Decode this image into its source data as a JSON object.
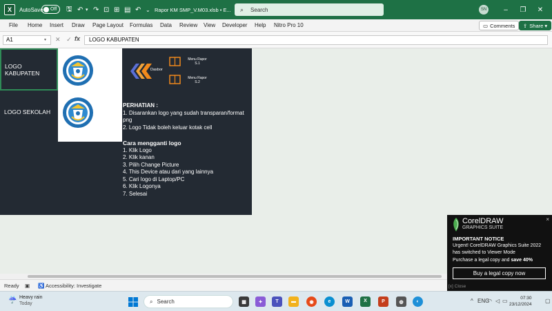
{
  "titlebar": {
    "excel_logo": "X",
    "autosave_label": "AutoSave",
    "autosave_state": "Off",
    "doc_title": "Rapor KM SMP_V.M03.xlsb  •  E...",
    "search_placeholder": "Search",
    "user_initials": "SN",
    "bg_color": "#1e7145"
  },
  "ribbon": {
    "tabs": [
      "File",
      "Home",
      "Insert",
      "Draw",
      "Page Layout",
      "Formulas",
      "Data",
      "Review",
      "View",
      "Developer",
      "Help",
      "Nitro Pro 10"
    ],
    "comments_label": "Comments",
    "share_label": "Share"
  },
  "formula_bar": {
    "name_box": "A1",
    "fx_label": "fx",
    "content": "LOGO KABUPATEN"
  },
  "sheet": {
    "cell_a1": "LOGO KABUPATEN",
    "cell_a2": "LOGO SEKOLAH",
    "nav": {
      "dasbor": "Dasbor",
      "menu1": "Menu Rapor S.1",
      "menu2": "Menu Rapor S.2"
    },
    "notice_title": "PERHATIAN :",
    "notice_lines": [
      "1. Disarankan logo yang sudah transparan/format png",
      "2. Logo Tidak boleh keluar kotak cell"
    ],
    "steps_title": "Cara mengganti logo",
    "steps": [
      "1. Klik Logo",
      "2. Klik kanan",
      "3. Pilih Change Picture",
      "4. This Device atau dari yang lainnya",
      "5. Cari logo di Laptop/PC",
      "6. Klik Logonya",
      "7. Selesai"
    ]
  },
  "status_bar": {
    "ready": "Ready",
    "accessibility": "Accessibility: Investigate"
  },
  "taskbar": {
    "weather_title": "Heavy rain",
    "weather_sub": "Today",
    "search_placeholder": "Search",
    "time": "07:30",
    "date": "23/12/2024",
    "lang": "ENG"
  },
  "corel_popup": {
    "brand": "CorelDRAW",
    "sub": "GRAPHICS SUITE",
    "heading": "IMPORTANT NOTICE",
    "message": "Urgent! CorelDRAW Graphics Suite 2022 has switched to Viewer Mode",
    "offer_prefix": "Purchase a legal copy and ",
    "offer_bold": "save 40%",
    "button": "Buy a legal copy now",
    "close_link": "[x] Close",
    "close_icon": "×"
  }
}
